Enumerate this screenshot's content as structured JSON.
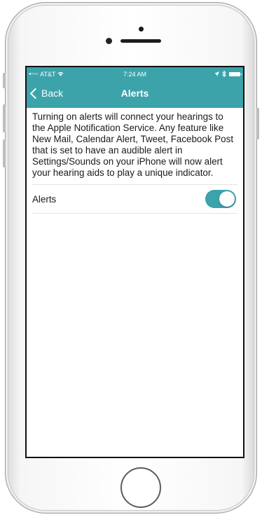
{
  "status_bar": {
    "carrier": "AT&T",
    "time": "7:24 AM"
  },
  "nav": {
    "back_label": "Back",
    "title": "Alerts"
  },
  "content": {
    "description": "Turning on alerts will connect your hearings to the Apple Notification Service.  Any feature like New Mail, Calendar Alert, Tweet, Facebook Post that is set to have an audible alert in Settings/Sounds on your iPhone will now alert your hearing aids to play a unique indicator.",
    "alerts_label": "Alerts",
    "alerts_enabled": true
  },
  "colors": {
    "accent": "#3ba3a9"
  },
  "icons": [
    "signal-icon",
    "wifi-icon",
    "location-icon",
    "bluetooth-icon",
    "battery-icon",
    "chevron-left-icon"
  ]
}
